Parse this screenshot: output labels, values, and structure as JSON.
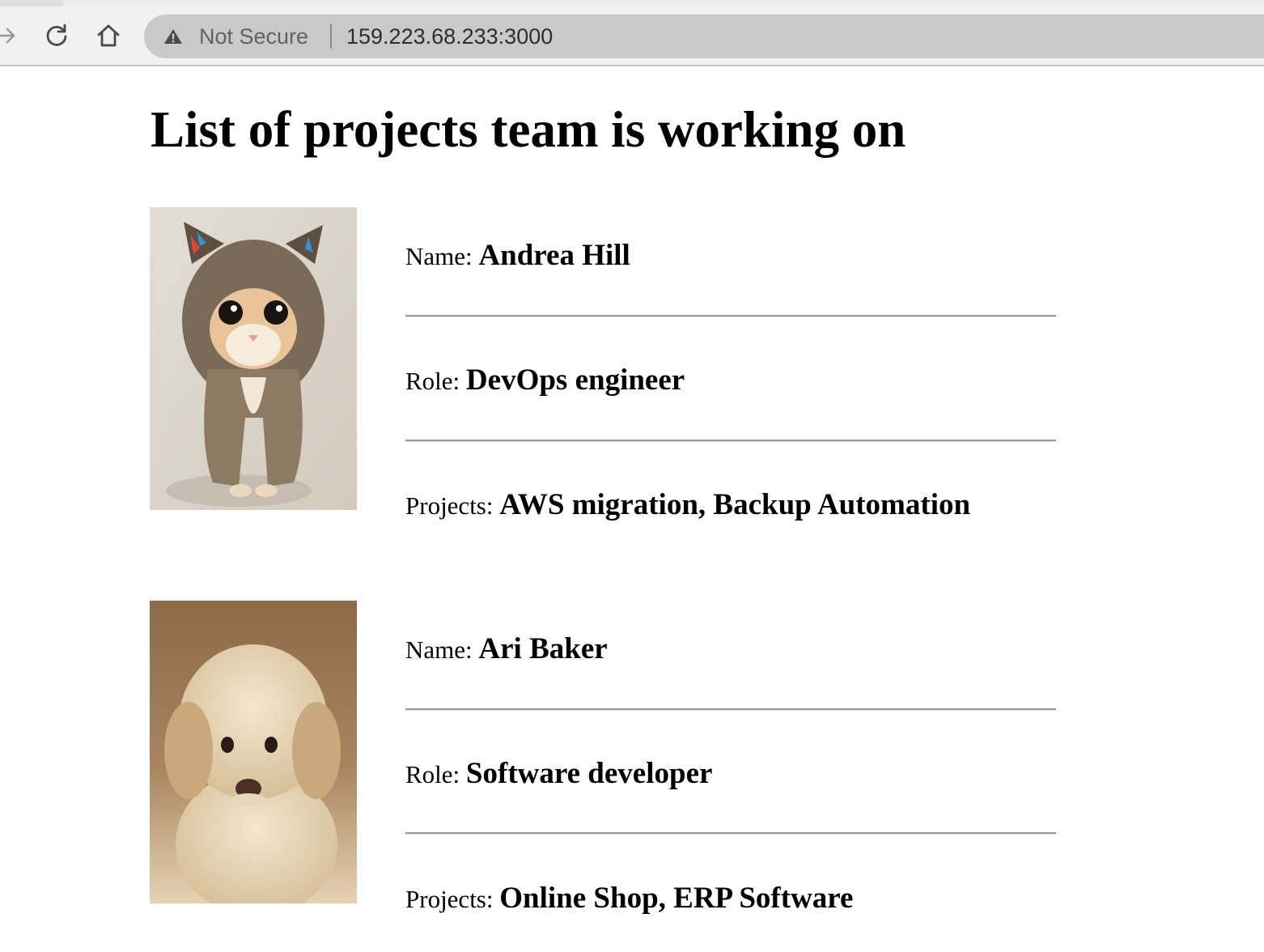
{
  "browser": {
    "security_label": "Not Secure",
    "url": "159.223.68.233:3000"
  },
  "page": {
    "title": "List of projects team is working on"
  },
  "labels": {
    "name": "Name:",
    "role": "Role:",
    "projects": "Projects:"
  },
  "team": [
    {
      "photo": "kitten-in-fur-hood-photo",
      "name": "Andrea Hill",
      "role": "DevOps engineer",
      "projects": "AWS migration, Backup Automation"
    },
    {
      "photo": "puppy-photo",
      "name": "Ari Baker",
      "role": "Software developer",
      "projects": "Online Shop, ERP Software"
    }
  ]
}
